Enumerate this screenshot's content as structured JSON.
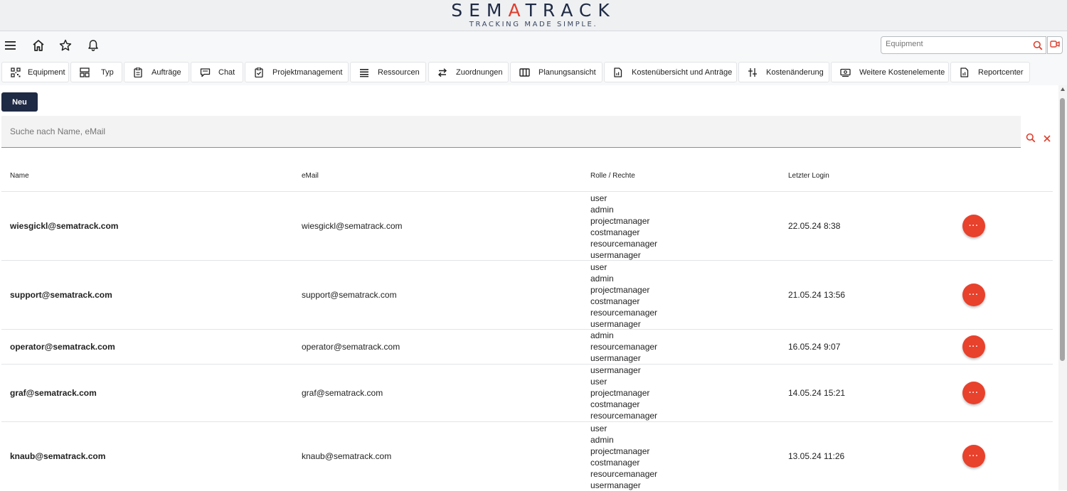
{
  "header": {
    "logo_part1": "SEM",
    "logo_accent": "A",
    "logo_part2": "TRACK",
    "tagline": "TRACKING MADE SIMPLE."
  },
  "toolbar": {
    "quick_search_placeholder": "Equipment"
  },
  "nav": [
    {
      "label": "Equipment",
      "icon": "grid-qr-icon"
    },
    {
      "label": "Typ",
      "icon": "layout-icon"
    },
    {
      "label": "Aufträge",
      "icon": "clipboard-icon"
    },
    {
      "label": "Chat",
      "icon": "chat-icon"
    },
    {
      "label": "Projektmanagement",
      "icon": "clipboard-check-icon"
    },
    {
      "label": "Ressourcen",
      "icon": "list-lines-icon"
    },
    {
      "label": "Zuordnungen",
      "icon": "swap-arrows-icon"
    },
    {
      "label": "Planungsansicht",
      "icon": "columns-icon"
    },
    {
      "label": "Kostenübersicht und Anträge",
      "icon": "report-file-icon"
    },
    {
      "label": "Kostenänderung",
      "icon": "sliders-icon"
    },
    {
      "label": "Weitere Kostenelemente",
      "icon": "money-icon"
    },
    {
      "label": "Reportcenter",
      "icon": "report-file-icon"
    }
  ],
  "main": {
    "new_button": "Neu",
    "search_placeholder": "Suche nach Name, eMail"
  },
  "table": {
    "columns": [
      "Name",
      "eMail",
      "Rolle / Rechte",
      "Letzter Login"
    ],
    "rows": [
      {
        "name": "wiesgickl@sematrack.com",
        "email": "wiesgickl@sematrack.com",
        "roles": [
          "user",
          "admin",
          "projectmanager",
          "costmanager",
          "resourcemanager",
          "usermanager"
        ],
        "last_login": "22.05.24 8:38"
      },
      {
        "name": "support@sematrack.com",
        "email": "support@sematrack.com",
        "roles": [
          "user",
          "admin",
          "projectmanager",
          "costmanager",
          "resourcemanager",
          "usermanager"
        ],
        "last_login": "21.05.24 13:56"
      },
      {
        "name": "operator@sematrack.com",
        "email": "operator@sematrack.com",
        "roles": [
          "admin",
          "resourcemanager",
          "usermanager"
        ],
        "last_login": "16.05.24 9:07"
      },
      {
        "name": "graf@sematrack.com",
        "email": "graf@sematrack.com",
        "roles": [
          "usermanager",
          "user",
          "projectmanager",
          "costmanager",
          "resourcemanager"
        ],
        "last_login": "14.05.24 15:21"
      },
      {
        "name": "knaub@sematrack.com",
        "email": "knaub@sematrack.com",
        "roles": [
          "user",
          "admin",
          "projectmanager",
          "costmanager",
          "resourcemanager",
          "usermanager"
        ],
        "last_login": "13.05.24 11:26"
      }
    ],
    "row_action_label": "···"
  },
  "colors": {
    "brand_dark": "#1f2a44",
    "accent": "#e03e2d"
  }
}
